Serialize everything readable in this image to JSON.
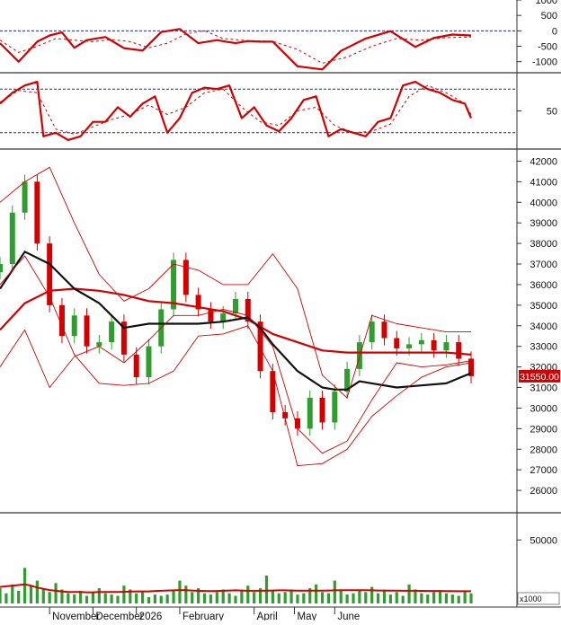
{
  "colors": {
    "up": "#2e9e2e",
    "down": "#d40000",
    "ma_red": "#d40000",
    "ma_black": "#111111",
    "band": "#d40000",
    "volume": "#2e9e2e",
    "ref_line": "#1a2a9a",
    "price_tag_bg": "#d40000",
    "price_tag_text": "#ffffff"
  },
  "chart_data": [
    {
      "type": "line",
      "panel": "macd",
      "y_ticks": [
        1000,
        500,
        0,
        -500,
        -1000
      ],
      "y_tick_labels": [
        "1000",
        "500",
        "0",
        "-500",
        "-1000"
      ],
      "ylim": [
        -1300,
        1000
      ],
      "ref_lines": [
        0
      ],
      "series": [
        {
          "style": "solid",
          "x": [
            0,
            6,
            12,
            16,
            20,
            24,
            28,
            34,
            40,
            46,
            52,
            58,
            64,
            70,
            76,
            80,
            84,
            88,
            96,
            104,
            110,
            118,
            126,
            134,
            140,
            146,
            152
          ],
          "y": [
            -400,
            -1000,
            -350,
            -150,
            -50,
            -550,
            -300,
            -200,
            -560,
            -640,
            -40,
            60,
            -400,
            -300,
            -400,
            -330,
            -350,
            -350,
            -1150,
            -1250,
            -650,
            -250,
            -10,
            -520,
            -230,
            -120,
            -150
          ]
        },
        {
          "style": "dashed",
          "x": [
            0,
            6,
            12,
            18,
            24,
            30,
            36,
            42,
            48,
            54,
            60,
            66,
            72,
            80,
            88,
            96,
            104,
            112,
            120,
            128,
            136,
            144,
            152
          ],
          "y": [
            -300,
            -700,
            -500,
            -250,
            -300,
            -350,
            -280,
            -350,
            -550,
            -400,
            -100,
            0,
            -250,
            -320,
            -340,
            -600,
            -1050,
            -850,
            -500,
            -250,
            -300,
            -220,
            -200
          ]
        }
      ]
    },
    {
      "type": "line",
      "panel": "rsi",
      "y_ticks": [
        50
      ],
      "y_tick_labels": [
        "50"
      ],
      "ylim": [
        0,
        100
      ],
      "ref_lines": [
        80,
        20
      ],
      "series": [
        {
          "style": "solid",
          "x": [
            0,
            4,
            8,
            12,
            14,
            18,
            22,
            26,
            30,
            34,
            38,
            42,
            46,
            50,
            54,
            58,
            62,
            66,
            70,
            74,
            78,
            82,
            86,
            90,
            94,
            98,
            102,
            106,
            110,
            114,
            118,
            122,
            126,
            130,
            134,
            138,
            142,
            146,
            150,
            152
          ],
          "y": [
            60,
            75,
            85,
            90,
            15,
            20,
            10,
            15,
            35,
            35,
            55,
            42,
            60,
            70,
            20,
            40,
            75,
            82,
            80,
            85,
            40,
            55,
            30,
            22,
            40,
            65,
            70,
            15,
            25,
            20,
            15,
            35,
            40,
            85,
            90,
            80,
            75,
            65,
            60,
            40
          ]
        },
        {
          "style": "dashed",
          "x": [
            0,
            6,
            12,
            18,
            24,
            30,
            36,
            42,
            48,
            54,
            60,
            66,
            72,
            78,
            84,
            90,
            96,
            102,
            108,
            114,
            120,
            126,
            132,
            138,
            144,
            150,
            152
          ],
          "y": [
            62,
            78,
            75,
            25,
            18,
            28,
            38,
            45,
            58,
            45,
            55,
            75,
            80,
            55,
            35,
            30,
            50,
            55,
            30,
            20,
            22,
            32,
            70,
            85,
            75,
            60,
            45
          ]
        }
      ]
    },
    {
      "type": "line",
      "panel": "price",
      "y_ticks": [
        42000,
        41000,
        40000,
        39000,
        38000,
        37000,
        36000,
        35000,
        34000,
        33000,
        32000,
        31000,
        30000,
        29000,
        28000,
        27000,
        26000
      ],
      "y_tick_labels": [
        "42000",
        "41000",
        "40000",
        "39000",
        "38000",
        "37000",
        "36000",
        "35000",
        "34000",
        "33000",
        "32000",
        "31000",
        "30000",
        "29000",
        "28000",
        "27000",
        "26000"
      ],
      "ylim": [
        25000,
        42500
      ],
      "last_price_label": "31550.00",
      "last_price": 31550,
      "candles_x": [
        0,
        4,
        8,
        12,
        16,
        20,
        24,
        28,
        32,
        36,
        40,
        44,
        48,
        52,
        56,
        60,
        64,
        68,
        72,
        76,
        80,
        84,
        88,
        92,
        96,
        100,
        104,
        108,
        112,
        116,
        120,
        124,
        128,
        132,
        136,
        140,
        144,
        148,
        152
      ],
      "candles_close": [
        37000,
        39500,
        41000,
        38000,
        35000,
        33500,
        34500,
        33000,
        33200,
        34200,
        32600,
        31500,
        33000,
        34800,
        37200,
        35500,
        34800,
        34200,
        34600,
        35300,
        34200,
        31800,
        29800,
        29500,
        29000,
        30500,
        29300,
        30800,
        31900,
        33200,
        34200,
        33400,
        32900,
        33100,
        33300,
        32800,
        33200,
        32400,
        31550
      ],
      "series": [
        {
          "name": "",
          "style": "ma-red",
          "x": [
            0,
            8,
            16,
            24,
            32,
            40,
            48,
            56,
            64,
            72,
            80,
            88,
            96,
            104,
            112,
            120,
            128,
            136,
            144,
            152
          ],
          "y": [
            33800,
            35100,
            35700,
            35800,
            35700,
            35500,
            35200,
            35100,
            34900,
            34700,
            34300,
            33600,
            33200,
            32800,
            32700,
            32700,
            32700,
            32700,
            32700,
            32600
          ]
        },
        {
          "name": "",
          "style": "ma-black",
          "x": [
            0,
            8,
            16,
            24,
            32,
            40,
            48,
            56,
            64,
            72,
            80,
            84,
            88,
            96,
            104,
            108,
            112,
            116,
            120,
            128,
            136,
            144,
            152
          ],
          "y": [
            35800,
            37600,
            37000,
            35800,
            35100,
            33900,
            34100,
            34100,
            34100,
            34200,
            34400,
            33900,
            33100,
            31800,
            31000,
            30900,
            30900,
            31300,
            31200,
            31000,
            31100,
            31200,
            31700
          ]
        },
        {
          "name": "",
          "style": "band",
          "x": [
            0,
            8,
            16,
            24,
            32,
            40,
            48,
            56,
            64,
            72,
            80,
            88,
            96,
            104,
            112,
            120,
            128,
            136,
            144,
            152
          ],
          "y": [
            40000,
            41000,
            41700,
            39000,
            36500,
            35200,
            35800,
            37000,
            36700,
            36000,
            36000,
            37500,
            35800,
            31600,
            30500,
            34500,
            34100,
            33900,
            33700,
            33700
          ]
        },
        {
          "name": "",
          "style": "band",
          "x": [
            0,
            8,
            16,
            24,
            32,
            40,
            48,
            56,
            64,
            72,
            80,
            88,
            96,
            104,
            112,
            120,
            128,
            136,
            144,
            152
          ],
          "y": [
            36000,
            37400,
            35400,
            32600,
            31200,
            31100,
            31200,
            31800,
            33500,
            33600,
            34000,
            31800,
            27200,
            27300,
            28000,
            29600,
            30600,
            31500,
            32000,
            32200
          ]
        },
        {
          "name": "",
          "style": "band",
          "x": [
            0,
            8,
            16,
            24,
            32,
            40,
            48,
            56,
            64,
            72,
            80,
            88,
            96,
            104,
            112,
            120,
            128,
            136,
            144,
            152
          ],
          "y": [
            32000,
            33800,
            31000,
            32500,
            33000,
            32200,
            33300,
            34500,
            34500,
            34800,
            34500,
            33000,
            29000,
            27800,
            28400,
            30400,
            32200,
            32000,
            32100,
            32300
          ]
        }
      ]
    },
    {
      "type": "bar",
      "panel": "volume",
      "y_ticks": [
        50000
      ],
      "y_tick_labels": [
        "50000"
      ],
      "y_unit_label": "x1000",
      "ylim": [
        0,
        70000
      ],
      "x": [
        0,
        2,
        4,
        6,
        8,
        10,
        12,
        14,
        16,
        18,
        20,
        22,
        24,
        26,
        28,
        30,
        32,
        34,
        36,
        38,
        40,
        42,
        44,
        46,
        48,
        50,
        52,
        54,
        56,
        58,
        60,
        62,
        64,
        66,
        68,
        70,
        72,
        74,
        76,
        78,
        80,
        82,
        84,
        86,
        88,
        90,
        92,
        94,
        96,
        98,
        100,
        102,
        104,
        106,
        108,
        110,
        112,
        114,
        116,
        118,
        120,
        122,
        124,
        126,
        128,
        130,
        132,
        134,
        136,
        138,
        140,
        142,
        144,
        146,
        148,
        150,
        152
      ],
      "values": [
        12000,
        8000,
        15000,
        10000,
        28000,
        14000,
        18000,
        12000,
        9000,
        16000,
        11000,
        8000,
        7000,
        10000,
        6000,
        9000,
        12000,
        8000,
        7000,
        6000,
        14000,
        11000,
        8000,
        9000,
        5000,
        7000,
        6000,
        7000,
        10000,
        18000,
        14000,
        9000,
        12000,
        8000,
        7000,
        9000,
        11000,
        8000,
        6000,
        10000,
        14000,
        9000,
        12000,
        22000,
        10000,
        8000,
        9000,
        11000,
        7000,
        8000,
        12000,
        15000,
        9000,
        8000,
        18000,
        10000,
        7000,
        8000,
        11000,
        9000,
        13000,
        8000,
        10000,
        7000,
        9000,
        6000,
        15000,
        11000,
        8000,
        7000,
        9000,
        10000,
        8000,
        7000,
        6000,
        9000,
        8000
      ],
      "ma": [
        13000,
        13500,
        14000,
        14500,
        15000,
        14000,
        12500,
        11500,
        10500,
        10000,
        9500,
        9000,
        9000,
        9000,
        8800,
        8800,
        9000,
        9000,
        9000,
        9000,
        9200,
        9300,
        9500,
        9500,
        9500,
        9800,
        10000,
        10200,
        10300,
        10500,
        10400,
        10200,
        10000,
        9800,
        9700,
        9800,
        10000,
        10200,
        10300,
        10200,
        10000,
        10000,
        10000,
        10100,
        10200,
        10300,
        10300,
        10200,
        10100,
        10100,
        10100,
        10100,
        10100,
        10200,
        10300,
        10400,
        10400,
        10400,
        10400,
        10400,
        10300,
        10200,
        10200,
        10100,
        10100,
        10000,
        10000,
        10000,
        9900,
        9800,
        9800,
        9800,
        9700,
        9700,
        9600,
        9600,
        9600
      ]
    }
  ],
  "x_axis": {
    "labels": [
      {
        "text": "November",
        "x": 16
      },
      {
        "text": "December",
        "x": 30
      },
      {
        "text": "2026",
        "x": 44
      },
      {
        "text": "February",
        "x": 58
      },
      {
        "text": "April",
        "x": 82
      },
      {
        "text": "May",
        "x": 95
      },
      {
        "text": "June",
        "x": 108
      }
    ],
    "domain": [
      0,
      152
    ]
  }
}
